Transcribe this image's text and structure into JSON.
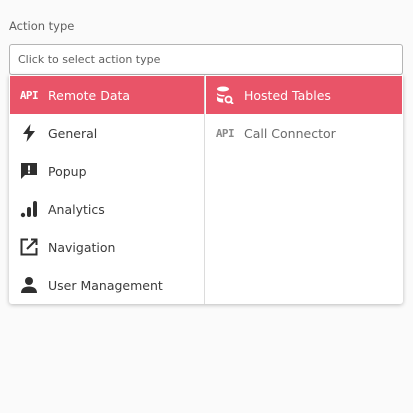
{
  "field": {
    "label": "Action type",
    "placeholder": "Click to select action type"
  },
  "menu": {
    "categories": [
      {
        "label": "Remote Data",
        "icon": "api-icon",
        "active": true
      },
      {
        "label": "General",
        "icon": "lightning-icon",
        "active": false
      },
      {
        "label": "Popup",
        "icon": "popup-alert-icon",
        "active": false
      },
      {
        "label": "Analytics",
        "icon": "bar-chart-icon",
        "active": false
      },
      {
        "label": "Navigation",
        "icon": "open-in-new-icon",
        "active": false
      },
      {
        "label": "User Management",
        "icon": "person-icon",
        "active": false
      }
    ],
    "actions": [
      {
        "label": "Hosted Tables",
        "icon": "database-search-icon",
        "active": true
      },
      {
        "label": "Call Connector",
        "icon": "api-icon",
        "active": false
      }
    ],
    "api_glyph": "API"
  },
  "colors": {
    "accent": "#e95468",
    "icon": "#2f2f2f",
    "icon_dim": "#8a8a8a"
  }
}
